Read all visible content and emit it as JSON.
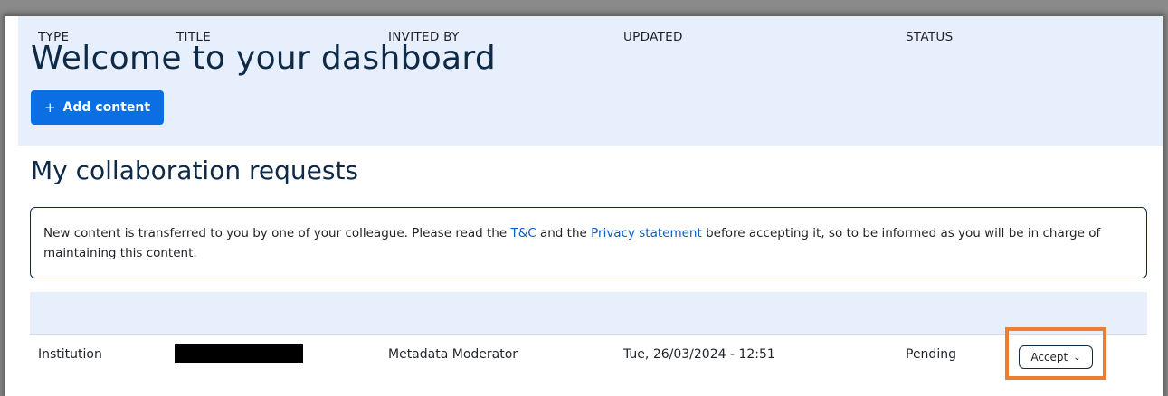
{
  "dashboard": {
    "title": "Welcome to your dashboard",
    "add_button": {
      "icon": "plus-icon",
      "label": "Add content"
    }
  },
  "collaboration": {
    "title": "My collaboration requests",
    "notice": {
      "text_before": "New content is transferred to you by one of your colleague. Please read the ",
      "link_tc": "T&C",
      "text_middle": " and the ",
      "link_privacy": "Privacy statement",
      "text_after": " before accepting it, so to be informed as you will be in charge of maintaining this content."
    },
    "table": {
      "columns": [
        "TYPE",
        "TITLE",
        "INVITED BY",
        "UPDATED",
        "STATUS"
      ],
      "rows": [
        {
          "type": "Institution",
          "title": "",
          "invited_by": "Metadata Moderator",
          "updated": "Tue, 26/03/2024 - 12:51",
          "status": "Pending",
          "action": {
            "label": "Accept",
            "icon": "chevron-down-icon"
          }
        }
      ]
    }
  },
  "colors": {
    "primary": "#0b6fe3",
    "heading": "#0e2a47",
    "panel_bg": "#e6effb",
    "link": "#0b5fc2",
    "highlight": "#ed7d31",
    "redaction": "#000000"
  }
}
